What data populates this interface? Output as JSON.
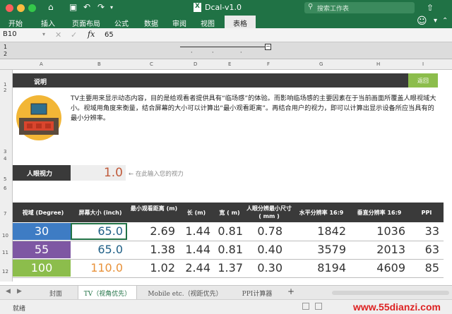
{
  "window": {
    "title": "Dcal-v1.0",
    "search_placeholder": "搜索工作表"
  },
  "ribbon": {
    "tabs": [
      "开始",
      "插入",
      "页面布局",
      "公式",
      "数据",
      "审阅",
      "视图"
    ],
    "active_tab": "表格"
  },
  "formula_bar": {
    "cell_ref": "B10",
    "fx": "fx",
    "value": "65"
  },
  "columns": [
    "A",
    "B",
    "C",
    "D",
    "E",
    "F",
    "G",
    "H",
    "I"
  ],
  "rows": [
    "1",
    "2",
    "3",
    "4",
    "5",
    "6",
    "7",
    "10",
    "11",
    "12"
  ],
  "group_levels": [
    "1",
    "2"
  ],
  "sheet": {
    "explain_label": "说明",
    "return_button": "返回",
    "description": "TV主要用来显示动态内容，目的是给观看者提供具有“临场感”的体验。而影响临场感的主要因素在于当前画面所覆盖人眼视域大小。视域用角度来衡量，结合屏幕的大小可以计算出“最小观看距离”。再结合用户的视力，即可以计算出显示设备所应当具有的最小分辨率。",
    "eye_label": "人眼视力",
    "eye_value": "1.0",
    "eye_hint": "← 在此输入您的视力",
    "table_headers": [
      "视域 (Degree)",
      "屏幕大小 (inch)",
      "最小观看距离 (m)",
      "长 (m)",
      "宽 ( m)",
      "人眼分辨最小尺寸 ( mm )",
      "水平分辨率 16:9",
      "垂直分辨率 16:9",
      "PPI"
    ],
    "table_rows": [
      {
        "degree": "30",
        "size": "65.0",
        "dist": "2.69",
        "len": "1.44",
        "wid": "0.81",
        "min": "0.78",
        "h": "1842",
        "v": "1036",
        "ppi": "33"
      },
      {
        "degree": "55",
        "size": "65.0",
        "dist": "1.38",
        "len": "1.44",
        "wid": "0.81",
        "min": "0.40",
        "h": "3579",
        "v": "2013",
        "ppi": "63"
      },
      {
        "degree": "100",
        "size": "110.0",
        "dist": "1.02",
        "len": "2.44",
        "wid": "1.37",
        "min": "0.30",
        "h": "8194",
        "v": "4609",
        "ppi": "85"
      }
    ],
    "row_colors": [
      "#3e7cc4",
      "#7e57a3",
      "#8cbd4c"
    ]
  },
  "sheet_tabs": [
    "封面",
    "TV（视角优先）",
    "Mobile etc.（视距优先）",
    "PPI计算器",
    "+"
  ],
  "status": {
    "text": "就绪",
    "watermark": "www.55dianzi.com"
  }
}
